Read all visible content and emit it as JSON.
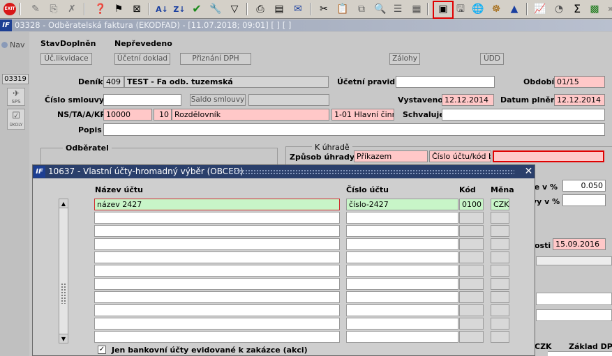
{
  "toolbar": {
    "exit_label": "EXIT"
  },
  "main_window": {
    "title": "03328 - Odběratelská faktura (EKODFAD) - [11.07.2018; 09:01]  [ ]  [ ]"
  },
  "left_panel": {
    "nav_label": "Nav",
    "code": "03319",
    "sps_label": "SPS",
    "ukoly_label": "ÚKOLY"
  },
  "status": {
    "stav_label": "Stav",
    "doplnen_label": "Doplněn",
    "neprevedeno_label": "Nepřevedeno"
  },
  "buttons": {
    "uc_likvidace": "Úč.likvidace",
    "ucetni_doklad": "Účetní doklad",
    "priznani_dph": "Přiznání DPH",
    "zalohy": "Zálohy",
    "udd": "ÚDD",
    "saldo_smlouvy": "Saldo smlouvy"
  },
  "form": {
    "denik_label": "Deník",
    "denik_code": "409",
    "denik_name": "TEST - Fa odb. tuzemská",
    "ucetni_pravidlo_label": "Účetní pravidlo",
    "ucetni_pravidlo_value": "",
    "obdobi_label": "Období",
    "obdobi_value": "01/15",
    "cislo_smlouvy_label": "Číslo smlouvy",
    "vystaveno_label": "Vystaveno",
    "vystaveno_value": "12.12.2014",
    "datum_plneni_label": "Datum plnění",
    "datum_plneni_value": "12.12.2014",
    "ns_label": "NS/TA/A/KP",
    "ns_value": "10000",
    "ta_value": "10",
    "ta_name": "Rozdělovník",
    "kp_value": "1-01 Hlavní činnos",
    "schvaluje_label": "Schvaluje",
    "popis_label": "Popis",
    "odberatel_label": "Odběratel",
    "k_uhrade_label": "K úhradě",
    "zpusob_uhrady_label": "Způsob úhrady",
    "zpusob_uhrady_value": "Příkazem",
    "cislo_uctu_kod_label": "Číslo účtu/kód bar",
    "pct_label_1": "le v %",
    "pct_value_1": "0.050",
    "pct_label_2": "vy v %",
    "date_label": "osti",
    "date_value": "15.09.2016",
    "czk_label": "CZK",
    "zaklad_dph_label": "Základ DPH"
  },
  "dialog": {
    "title": "10637 - Vlastní účty-hromadný výběr (OBCED)",
    "col_nazev": "Název účtu",
    "col_cislo": "Číslo účtu",
    "col_kod": "Kód",
    "col_mena": "Měna",
    "rows": [
      {
        "nazev": "název 2427",
        "cislo": "číslo-2427",
        "kod": "0100",
        "mena": "CZK"
      }
    ],
    "checkbox_label": "Jen bankovní účty evidované k zakázce (akci)",
    "checkbox_checked": true
  }
}
